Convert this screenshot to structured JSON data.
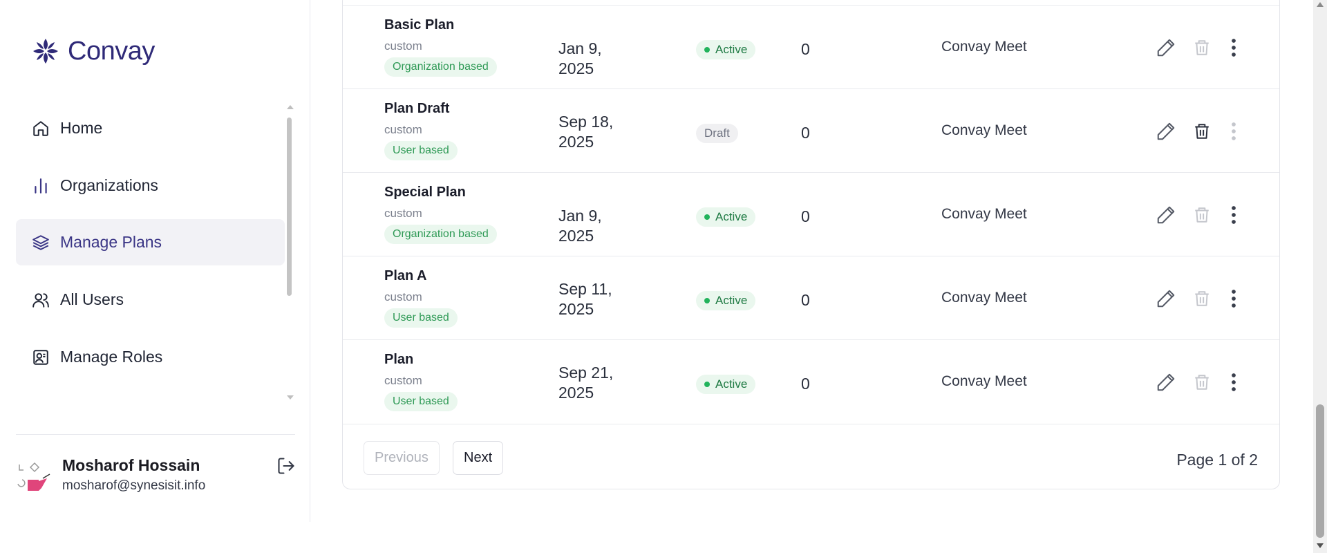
{
  "app": {
    "name": "Convay",
    "brand_color": "#2f2a78"
  },
  "sidebar": {
    "items": [
      {
        "label": "Home",
        "icon": "home-icon",
        "active": false
      },
      {
        "label": "Organizations",
        "icon": "bar-chart-icon",
        "active": false
      },
      {
        "label": "Manage Plans",
        "icon": "layers-icon",
        "active": true
      },
      {
        "label": "All Users",
        "icon": "users-icon",
        "active": false
      },
      {
        "label": "Manage Roles",
        "icon": "user-card-icon",
        "active": false
      }
    ]
  },
  "user": {
    "name": "Mosharof Hossain",
    "email": "mosharof@synesisit.info"
  },
  "plans": {
    "rows": [
      {
        "name": "Basic Plan",
        "type": "custom",
        "basis": "Organization based",
        "date": "Jan 9, 2025",
        "status": "Active",
        "count": "0",
        "product": "Convay Meet"
      },
      {
        "name": "Plan Draft",
        "type": "custom",
        "basis": "User based",
        "date": "Sep 18, 2025",
        "status": "Draft",
        "count": "0",
        "product": "Convay Meet"
      },
      {
        "name": "Special Plan",
        "type": "custom",
        "basis": "Organization based",
        "date": "Jan 9, 2025",
        "status": "Active",
        "count": "0",
        "product": "Convay Meet"
      },
      {
        "name": "Plan A",
        "type": "custom",
        "basis": "User based",
        "date": "Sep 11, 2025",
        "status": "Active",
        "count": "0",
        "product": "Convay Meet"
      },
      {
        "name": "Plan",
        "type": "custom",
        "basis": "User based",
        "date": "Sep 21, 2025",
        "status": "Active",
        "count": "0",
        "product": "Convay Meet"
      }
    ]
  },
  "pagination": {
    "previous_label": "Previous",
    "next_label": "Next",
    "page_info": "Page 1 of 2"
  },
  "colors": {
    "active_status": "#22b35c",
    "tag_green": "#2f9a56"
  }
}
